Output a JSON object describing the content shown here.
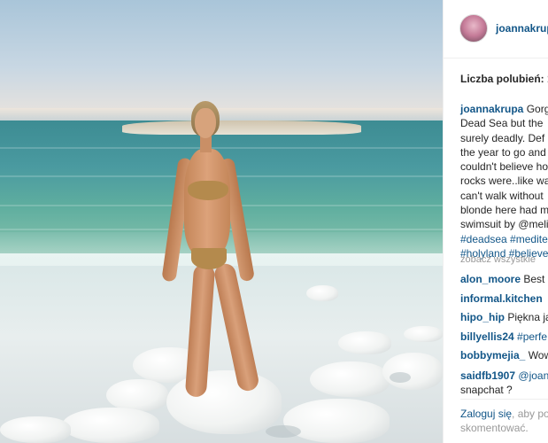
{
  "post": {
    "username": "joannakrupa",
    "likes_label": "Liczba polubień: 1",
    "caption": {
      "author": "joannakrupa",
      "lines": [
        "Gorg",
        "Dead Sea but the",
        "surely deadly. Def",
        "the year to go and",
        "couldn't believe ho",
        "rocks were..like wa",
        "can't walk without",
        "blonde here had m",
        "swimsuit by @meli"
      ],
      "hashtags_line1": "#deadsea #medite",
      "hashtags_line2": "#holyland #believe"
    },
    "view_all_label": "zobacz wszystkie",
    "comments": [
      {
        "user": "alon_moore",
        "text": " Best"
      },
      {
        "user": "informal.kitchen",
        "text": " 🍴"
      },
      {
        "user": "hipo_hip",
        "text": " Piękna ja"
      },
      {
        "user": "billyellis24",
        "text": "",
        "mention": " #perfe"
      },
      {
        "user": "bobbymejia_",
        "text": " Wow"
      },
      {
        "user": "saidfb1907",
        "text": "",
        "mention": " @joann"
      }
    ],
    "comment_continuation": "snapchat ?",
    "login_prompt": {
      "link": "Zaloguj się",
      "text": ", aby po",
      "line2": "skomentować."
    }
  },
  "colors": {
    "link": "#125688",
    "muted": "#999999",
    "text": "#262626"
  }
}
